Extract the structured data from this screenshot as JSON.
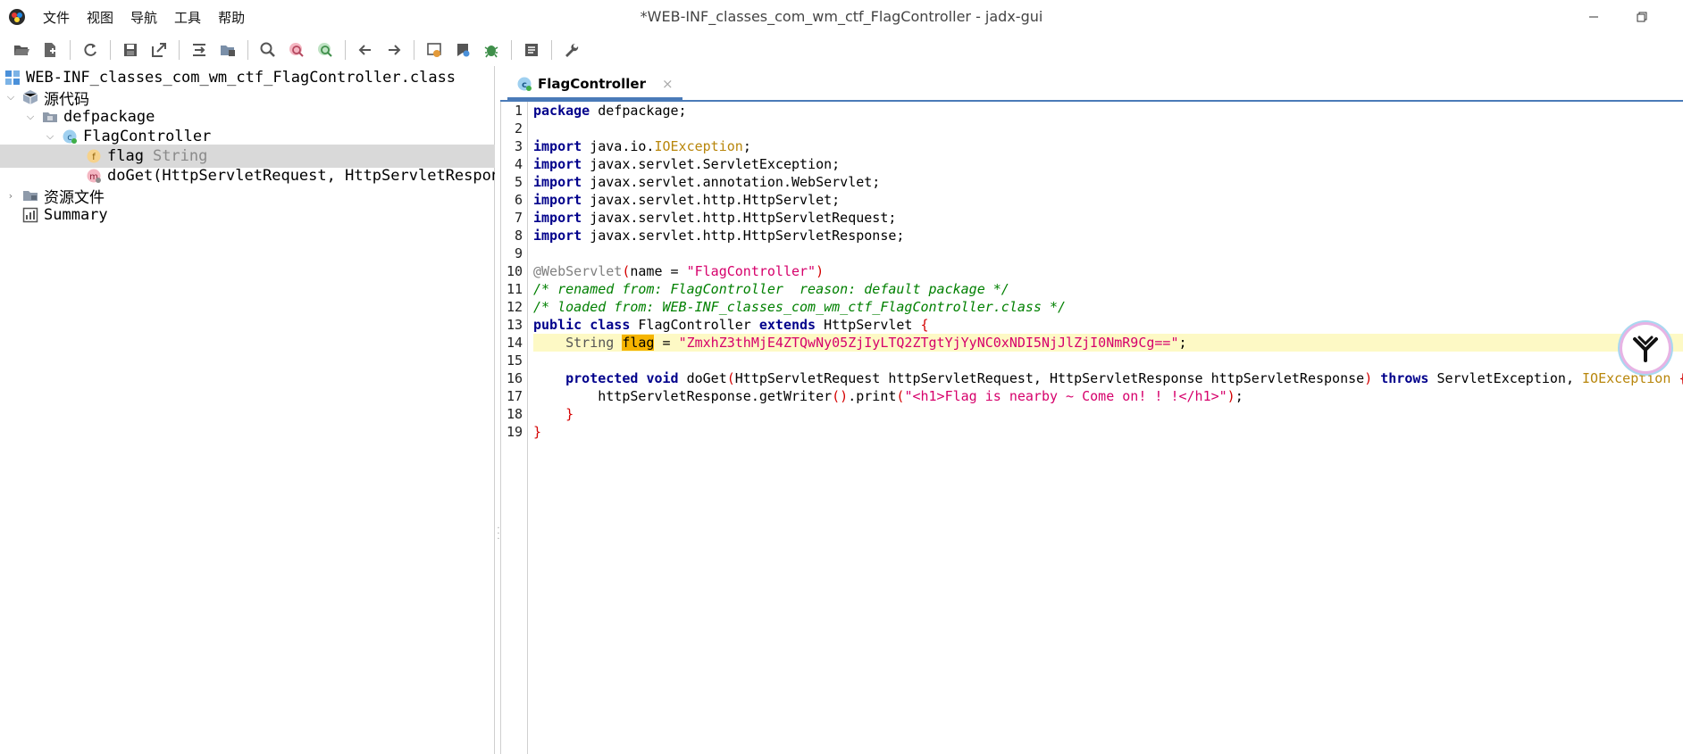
{
  "window": {
    "title": "*WEB-INF_classes_com_wm_ctf_FlagController - jadx-gui",
    "app_icon": "jadx-logo-icon",
    "controls": [
      "minimize-icon",
      "restore-icon"
    ]
  },
  "menu": [
    "文件",
    "视图",
    "导航",
    "工具",
    "帮助"
  ],
  "toolbar": {
    "icons": [
      "open-file-icon",
      "add-files-icon",
      "sync-icon",
      "save-icon",
      "export-icon",
      "sync-tree-icon",
      "flatten-packages-icon",
      "search-icon",
      "find-class-icon",
      "find-usage-icon",
      "back-icon",
      "forward-icon",
      "deobfuscation-icon",
      "quark-icon",
      "debug-icon",
      "log-icon",
      "preferences-icon"
    ]
  },
  "tree": {
    "root": "WEB-INF_classes_com_wm_ctf_FlagController.class",
    "source_code": "源代码",
    "package": "defpackage",
    "class": "FlagController",
    "field_name": "flag",
    "field_type": "String",
    "method": "doGet(HttpServletRequest, HttpServletRespon",
    "resources": "资源文件",
    "summary": "Summary"
  },
  "editor": {
    "tab_label": "FlagController",
    "tab_close": "×",
    "line_numbers": [
      "1",
      "2",
      "3",
      "4",
      "5",
      "6",
      "7",
      "8",
      "9",
      "10",
      "11",
      "12",
      "13",
      "14",
      "15",
      "16",
      "17",
      "18",
      "19"
    ],
    "code": {
      "l1_kw": "package",
      "l1_rest": " defpackage;",
      "l3_kw": "import",
      "l3_a": " java.io.",
      "l3_b": "IOException",
      "l3_c": ";",
      "l4_kw": "import",
      "l4_rest": " javax.servlet.ServletException;",
      "l5_kw": "import",
      "l5_rest": " javax.servlet.annotation.WebServlet;",
      "l6_kw": "import",
      "l6_rest": " javax.servlet.http.HttpServlet;",
      "l7_kw": "import",
      "l7_rest": " javax.servlet.http.HttpServletRequest;",
      "l8_kw": "import",
      "l8_rest": " javax.servlet.http.HttpServletResponse;",
      "l10_ann": "@WebServlet",
      "l10_p1": "(",
      "l10_a": "name = ",
      "l10_str": "\"FlagController\"",
      "l10_p2": ")",
      "l11": "/* renamed from: FlagController  reason: default package */",
      "l12": "/* loaded from: WEB-INF_classes_com_wm_ctf_FlagController.class */",
      "l13_kw1": "public",
      "l13_kw2": "class",
      "l13_a": " FlagController ",
      "l13_kw3": "extends",
      "l13_b": " HttpServlet ",
      "l13_brace": "{",
      "l14_indent": "    ",
      "l14_type": "String",
      "l14_sp": " ",
      "l14_field": "flag",
      "l14_eq": " = ",
      "l14_str": "\"ZmxhZ3thMjE4ZTQwNy05ZjIyLTQ2ZTgtYjYyNC0xNDI5NjJlZjI0NmR9Cg==\"",
      "l14_end": ";",
      "l16_indent": "    ",
      "l16_kw1": "protected",
      "l16_kw2": "void",
      "l16_a": " doGet",
      "l16_p1": "(",
      "l16_b": "HttpServletRequest httpServletRequest, HttpServletResponse httpServletResponse",
      "l16_p2": ")",
      "l16_kw3": "throws",
      "l16_c": " ServletException, ",
      "l16_d": "IOException",
      "l16_e": " {",
      "l17_indent": "        ",
      "l17_a": "httpServletResponse.getWriter",
      "l17_p": "()",
      "l17_b": ".print",
      "l17_p1": "(",
      "l17_str": "\"<h1>Flag is nearby ~ Come on! ! !</h1>\"",
      "l17_p2": ")",
      "l17_c": ";",
      "l18": "    }",
      "l19": "}"
    }
  }
}
